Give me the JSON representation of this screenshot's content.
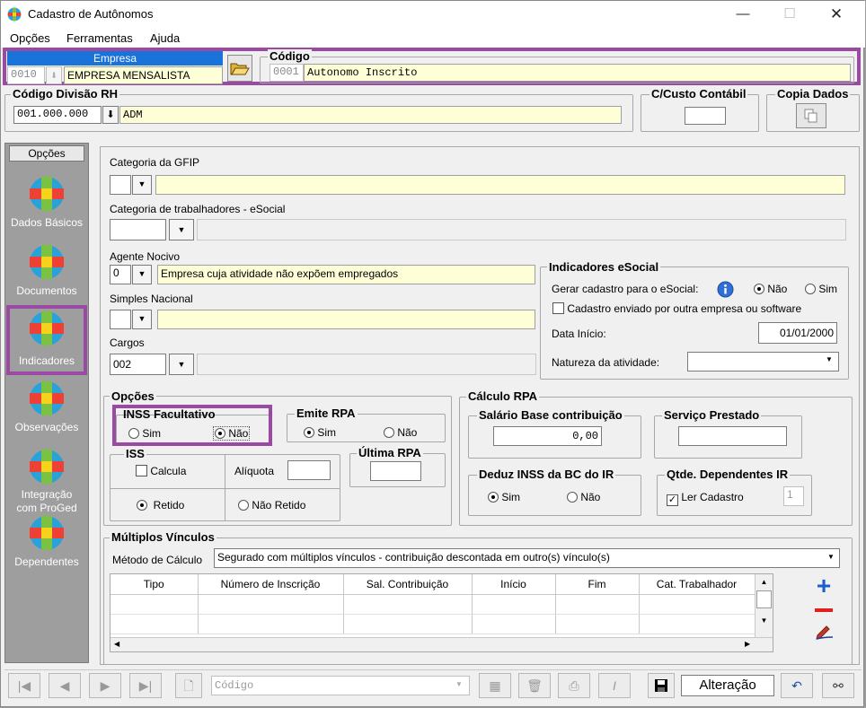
{
  "window": {
    "title": "Cadastro de Autônomos",
    "menu": [
      "Opções",
      "Ferramentas",
      "Ajuda"
    ]
  },
  "empresa": {
    "label": "Empresa",
    "code": "0010",
    "name": "EMPRESA MENSALISTA"
  },
  "codigo": {
    "label": "Código",
    "code": "0001",
    "name": "Autonomo  Inscrito"
  },
  "divisao": {
    "label": "Código Divisão RH",
    "code": "001.000.000",
    "name": "ADM"
  },
  "custo": {
    "label": "C/Custo Contábil"
  },
  "copia": {
    "label": "Copia Dados"
  },
  "sidebar": {
    "header": "Opções",
    "items": [
      {
        "label": "Dados Básicos"
      },
      {
        "label": "Documentos"
      },
      {
        "label": "Indicadores"
      },
      {
        "label": "Observações"
      },
      {
        "label": "Integração com ProGed"
      },
      {
        "label": "Dependentes"
      }
    ]
  },
  "gfip": {
    "label": "Categoria da GFIP",
    "code": "",
    "desc": ""
  },
  "esocial_cat": {
    "label": "Categoria de trabalhadores - eSocial",
    "code": ""
  },
  "agente": {
    "label": "Agente  Nocivo",
    "code": "0",
    "desc": "Empresa cuja atividade não expõem empregados"
  },
  "simples": {
    "label": "Simples Nacional",
    "code": "",
    "desc": ""
  },
  "cargos": {
    "label": "Cargos",
    "code": "002"
  },
  "indicadores": {
    "title": "Indicadores eSocial",
    "gerar_label": "Gerar cadastro para o eSocial:",
    "nao": "Não",
    "sim": "Sim",
    "enviado_label": "Cadastro enviado por outra empresa ou software",
    "data_inicio_label": "Data Início:",
    "data_inicio": "01/01/2000",
    "natureza_label": "Natureza da atividade:"
  },
  "opcoes": {
    "title": "Opções",
    "inss": {
      "title": "INSS Facultativo",
      "sim": "Sim",
      "nao": "Não"
    },
    "emite": {
      "title": "Emite RPA",
      "sim": "Sim",
      "nao": "Não"
    },
    "iss": {
      "title": "ISS",
      "calcula": "Calcula",
      "aliquota": "Alíquota",
      "retido": "Retido",
      "nao_retido": "Não Retido"
    },
    "ultima": {
      "title": "Última RPA"
    }
  },
  "calculo": {
    "title": "Cálculo RPA",
    "salario": {
      "title": "Salário Base contribuição",
      "value": "0,00"
    },
    "servico": {
      "title": "Serviço Prestado"
    },
    "deduz": {
      "title": "Deduz INSS da BC do IR",
      "sim": "Sim",
      "nao": "Não"
    },
    "qtde": {
      "title": "Qtde. Dependentes IR",
      "ler": "Ler Cadastro",
      "value": "1"
    }
  },
  "multiplos": {
    "title": "Múltiplos Vínculos",
    "metodo_label": "Método de Cálculo",
    "metodo_value": "Segurado com múltiplos vínculos - contribuição descontada em outro(s) vínculo(s)",
    "columns": [
      "Tipo",
      "Número de Inscrição",
      "Sal. Contribuição",
      "Início",
      "Fim",
      "Cat. Trabalhador"
    ]
  },
  "footer": {
    "search_placeholder": "Código",
    "status": "Alteração"
  },
  "colors": {
    "highlight": "#9b4aa3",
    "yellow_field": "#ffffd7",
    "blue_header": "#1a73d9"
  }
}
